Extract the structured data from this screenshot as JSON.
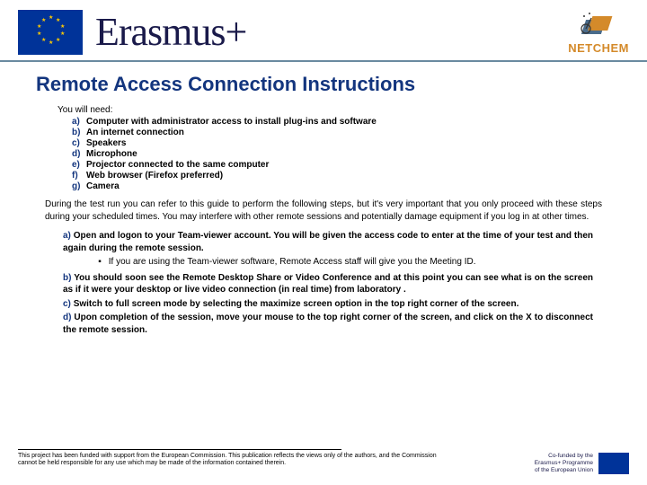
{
  "header": {
    "brand": "Erasmus+",
    "netchem_label": "NETCHEM"
  },
  "title": "Remote Access Connection Instructions",
  "need_intro": "You will need:",
  "needs": [
    {
      "marker": "a)",
      "text": "Computer with administrator access to install plug-ins and software"
    },
    {
      "marker": "b)",
      "text": "An internet connection"
    },
    {
      "marker": "c)",
      "text": "Speakers"
    },
    {
      "marker": "d)",
      "text": "Microphone"
    },
    {
      "marker": "e)",
      "text": "Projector connected to the same computer"
    },
    {
      "marker": "f)",
      "text": "Web browser (Firefox preferred)"
    },
    {
      "marker": "g)",
      "text": "Camera"
    }
  ],
  "paragraph": "During the test run you can refer to this guide to perform the following steps, but it's very important that you only proceed with these steps during your scheduled times. You may interfere with other remote sessions and potentially damage equipment if you log in at other times.",
  "steps": {
    "a_marker": "a)",
    "a_text": "Open and logon to your Team-viewer account. You will be given the access code to enter at the time of your test and then again during the remote session.",
    "a_sub_bullet": "▪",
    "a_sub": "If you are using the Team-viewer software, Remote Access staff will give you the Meeting ID.",
    "b_marker": "b)",
    "b_text": "You should soon see the Remote Desktop Share or Video Conference and at this point you can see what is on the screen as if it were your desktop or live video connection (in real time) from laboratory .",
    "c_marker": "c)",
    "c_text": "Switch to full screen mode by selecting the maximize screen option in the top right corner of the screen.",
    "d_marker": "d)",
    "d_text": "Upon completion of the session, move your mouse to the top right corner of the screen, and click on the X to disconnect the remote session."
  },
  "footer": {
    "disclaimer": "This project has been funded with support from the European Commission. This publication reflects the views only of the authors, and the Commission cannot be held responsible for any use which may be made of the information contained therein.",
    "cofund_l1": "Co-funded by the",
    "cofund_l2": "Erasmus+ Programme",
    "cofund_l3": "of the European Union"
  }
}
